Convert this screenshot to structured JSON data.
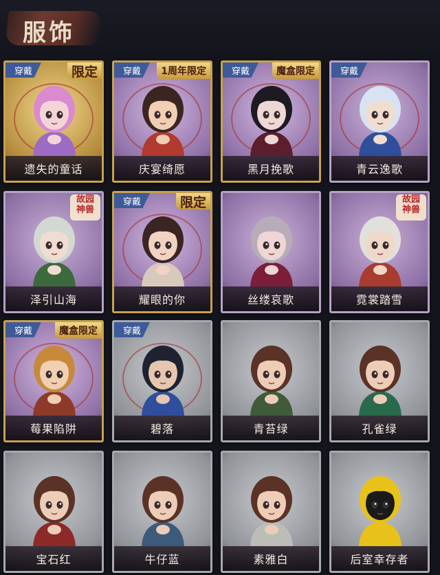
{
  "header": {
    "title": "服饰"
  },
  "wear_label": "穿戴",
  "cards": [
    {
      "name": "遗失的童话",
      "style": "gold",
      "wear": true,
      "badge": "限定",
      "badge_big": true,
      "hair": "#d98ad0",
      "skin": "#f3d5d8",
      "cloth": "#9d6bc4"
    },
    {
      "name": "庆宴绮愿",
      "style": "purplegold",
      "wear": true,
      "badge": "1周年限定",
      "badge_big": false,
      "hair": "#3a2520",
      "skin": "#f0cfb5",
      "cloth": "#b23a2e"
    },
    {
      "name": "黑月挽歌",
      "style": "purplegold",
      "wear": true,
      "badge": "魔盒限定",
      "badge_big": false,
      "hair": "#1e1a22",
      "skin": "#eed7d4",
      "cloth": "#5c1e2c"
    },
    {
      "name": "青云逸歌",
      "style": "purple",
      "wear": true,
      "badge": "",
      "badge_big": false,
      "hair": "#d7e3f0",
      "skin": "#f1dcd0",
      "cloth": "#2f4f9c"
    },
    {
      "name": "泽引山海",
      "style": "purple",
      "wear": false,
      "stamp": "故园神兽",
      "badge": "",
      "hair": "#d3d8d3",
      "skin": "#f0dcd0",
      "cloth": "#3c6a3c"
    },
    {
      "name": "耀眼的你",
      "style": "purplegold",
      "wear": true,
      "badge": "限定",
      "badge_big": true,
      "hair": "#3a2522",
      "skin": "#f1d3c4",
      "cloth": "#d8c9bd"
    },
    {
      "name": "丝缕哀歌",
      "style": "purple",
      "wear": false,
      "badge": "",
      "hair": "#b7adb8",
      "skin": "#eed6d4",
      "cloth": "#7a1e3a"
    },
    {
      "name": "霓裳踏雪",
      "style": "purple",
      "wear": false,
      "stamp": "故园神兽",
      "badge": "",
      "hair": "#e2e0dc",
      "skin": "#f0d8c8",
      "cloth": "#a83c2e"
    },
    {
      "name": "莓果陷阱",
      "style": "purplegold",
      "wear": true,
      "badge": "魔盒限定",
      "badge_big": false,
      "hair": "#c7893c",
      "skin": "#f0cfb2",
      "cloth": "#8e3a2a"
    },
    {
      "name": "碧落",
      "style": "gray",
      "wear": true,
      "badge": "",
      "hair": "#1f2230",
      "skin": "#e5c7b1",
      "cloth": "#2f4f9c"
    },
    {
      "name": "青苔绿",
      "style": "gray",
      "wear": false,
      "badge": "",
      "hair": "#5a3226",
      "skin": "#edcdb8",
      "cloth": "#3f5b3a"
    },
    {
      "name": "孔雀绿",
      "style": "gray",
      "wear": false,
      "badge": "",
      "hair": "#5a3226",
      "skin": "#edcdb8",
      "cloth": "#2a6a4c"
    },
    {
      "name": "宝石红",
      "style": "gray",
      "wear": false,
      "badge": "",
      "hair": "#5a3226",
      "skin": "#edcdb8",
      "cloth": "#8c2a28"
    },
    {
      "name": "牛仔蓝",
      "style": "gray",
      "wear": false,
      "badge": "",
      "hair": "#5a3226",
      "skin": "#edcdb8",
      "cloth": "#3d5a7c"
    },
    {
      "name": "素雅白",
      "style": "gray",
      "wear": false,
      "badge": "",
      "hair": "#5a3226",
      "skin": "#edcdb8",
      "cloth": "#bdbdb8"
    },
    {
      "name": "后室幸存者",
      "style": "gray",
      "wear": false,
      "badge": "",
      "hair": "#e8c21a",
      "skin": "#1a1a1a",
      "cloth": "#e8c21a"
    }
  ]
}
